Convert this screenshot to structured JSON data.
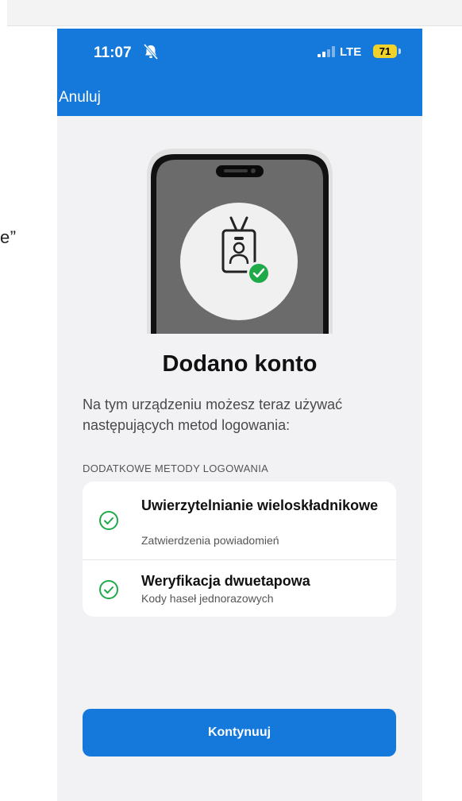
{
  "side_text": "e”",
  "status_bar": {
    "time": "11:07",
    "network": "LTE",
    "battery": "71"
  },
  "nav": {
    "cancel_label": "Anuluj"
  },
  "colors": {
    "accent": "#1479db",
    "success": "#1faa4a",
    "battery": "#f1d22b"
  },
  "illustration": {
    "icons": [
      "id-badge-icon",
      "checkmark-badge-icon"
    ]
  },
  "main": {
    "title": "Dodano konto",
    "description": "Na tym urządzeniu możesz teraz używać następujących metod logowania:",
    "section_label": "DODATKOWE METODY LOGOWANIA",
    "methods": [
      {
        "title": "Uwierzytelnianie wieloskładnikowe",
        "subtitle": "Zatwierdzenia powiadomień",
        "icon": "check-circle-icon"
      },
      {
        "title": "Weryfikacja dwuetapowa",
        "subtitle": "Kody haseł jednorazowych",
        "icon": "check-circle-icon"
      }
    ],
    "continue_label": "Kontynuuj"
  }
}
